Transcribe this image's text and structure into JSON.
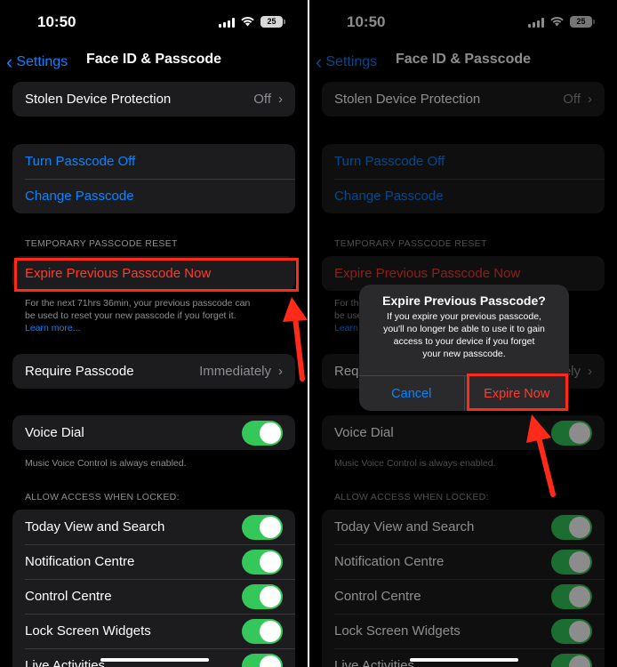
{
  "status": {
    "time": "10:50",
    "battery": "25"
  },
  "nav": {
    "back_label": "Settings",
    "title": "Face ID & Passcode"
  },
  "stolen_device": {
    "label": "Stolen Device Protection",
    "value": "Off"
  },
  "passcode": {
    "turn_off": "Turn Passcode Off",
    "change": "Change Passcode"
  },
  "temp_reset": {
    "header": "TEMPORARY PASSCODE RESET",
    "expire_label": "Expire Previous Passcode Now",
    "footnote_line1": "For the next 71hrs 36min, your previous passcode can",
    "footnote_line2": "be used to reset your new passcode if you forget it.",
    "learn_more": "Learn more...",
    "footnote_right_cut1": "For the next 71hrs 36min, your previous passcode can",
    "footnote_right_cut2": "be used to reset your new passcode if you forget it.",
    "learn_more_cut": "Learn more..."
  },
  "require_passcode": {
    "label": "Require Passcode",
    "value": "Immediately"
  },
  "voice_dial": {
    "label": "Voice Dial",
    "footnote": "Music Voice Control is always enabled."
  },
  "locked_access": {
    "header": "ALLOW ACCESS WHEN LOCKED:",
    "items": [
      "Today View and Search",
      "Notification Centre",
      "Control Centre",
      "Lock Screen Widgets",
      "Live Activities"
    ]
  },
  "alert": {
    "title": "Expire Previous Passcode?",
    "message_line1": "If you expire your previous passcode,",
    "message_line2": "you'll no longer be able to use it to gain",
    "message_line3": "access to your device if you forget",
    "message_line4": "your new passcode.",
    "cancel": "Cancel",
    "confirm": "Expire Now"
  },
  "colors": {
    "accent": "#0a84ff",
    "destructive": "#ff3b30",
    "toggle_on": "#34c759",
    "annotation": "#ff2a1a"
  }
}
